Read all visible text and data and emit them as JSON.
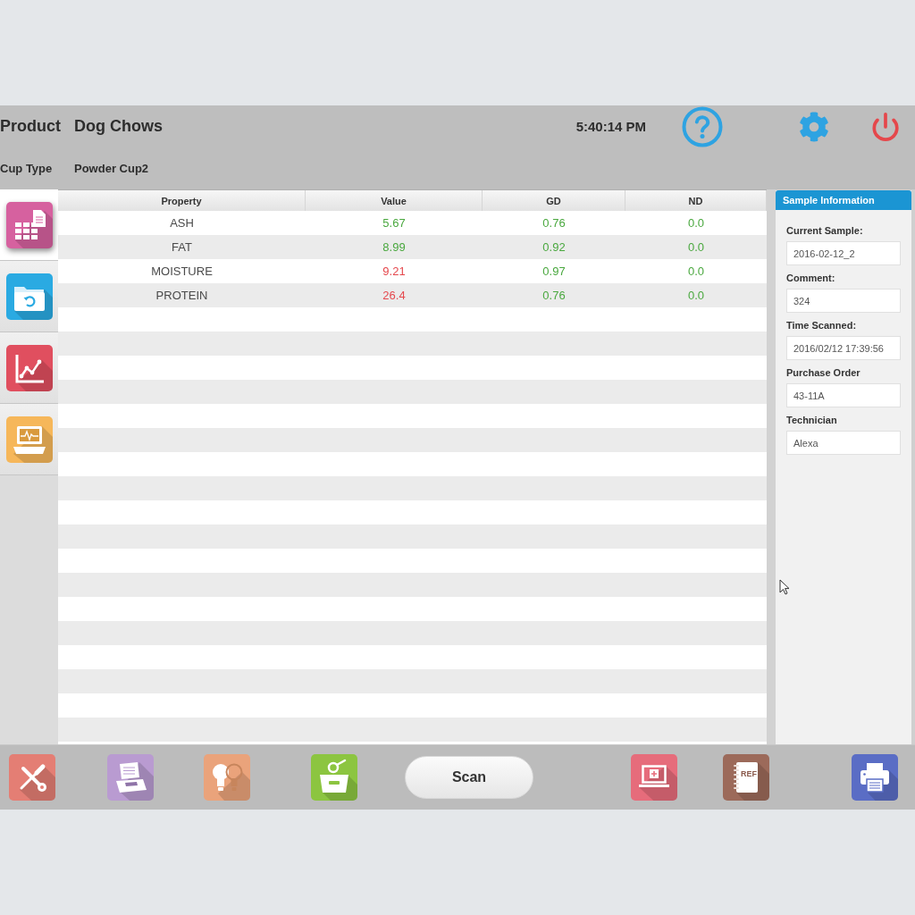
{
  "header": {
    "product_label": "Product",
    "product": "Dog Chows",
    "time": "5:40:14 PM",
    "cup_type_label": "Cup Type",
    "cup_type": "Powder Cup2"
  },
  "sidebar": {
    "tabs": [
      {
        "selected": true
      },
      {
        "selected": false
      },
      {
        "selected": false
      },
      {
        "selected": false
      }
    ]
  },
  "table": {
    "columns": [
      "Property",
      "Value",
      "GD",
      "ND"
    ],
    "rows": [
      {
        "property": "ASH",
        "value": "5.67",
        "flagged": false,
        "gd": "0.76",
        "nd": "0.0"
      },
      {
        "property": "FAT",
        "value": "8.99",
        "flagged": false,
        "gd": "0.92",
        "nd": "0.0"
      },
      {
        "property": "MOISTURE",
        "value": "9.21",
        "flagged": true,
        "gd": "0.97",
        "nd": "0.0"
      },
      {
        "property": "PROTEIN",
        "value": "26.4",
        "flagged": true,
        "gd": "0.76",
        "nd": "0.0"
      }
    ]
  },
  "sample_information": {
    "title": "Sample Information",
    "fields": [
      {
        "label": "Current Sample:",
        "value": "2016-02-12_2"
      },
      {
        "label": "Comment:",
        "value": "324"
      },
      {
        "label": "Time Scanned:",
        "value": "2016/02/12 17:39:56"
      },
      {
        "label": "Purchase Order",
        "value": "43-11A"
      },
      {
        "label": "Technician",
        "value": "Alexa"
      }
    ]
  },
  "toolbar": {
    "scan_button": "Scan",
    "reference_label": "REF"
  }
}
